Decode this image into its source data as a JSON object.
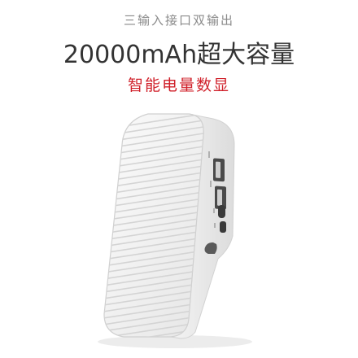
{
  "header": {
    "subtitle": "三输入接口双输出",
    "title": "20000mAh超大容量",
    "tagline": "智能电量数显"
  },
  "colors": {
    "subtitle": "#8a8a8a",
    "title": "#333333",
    "tagline": "#d0202a",
    "device_body": "#f2f2f2"
  }
}
